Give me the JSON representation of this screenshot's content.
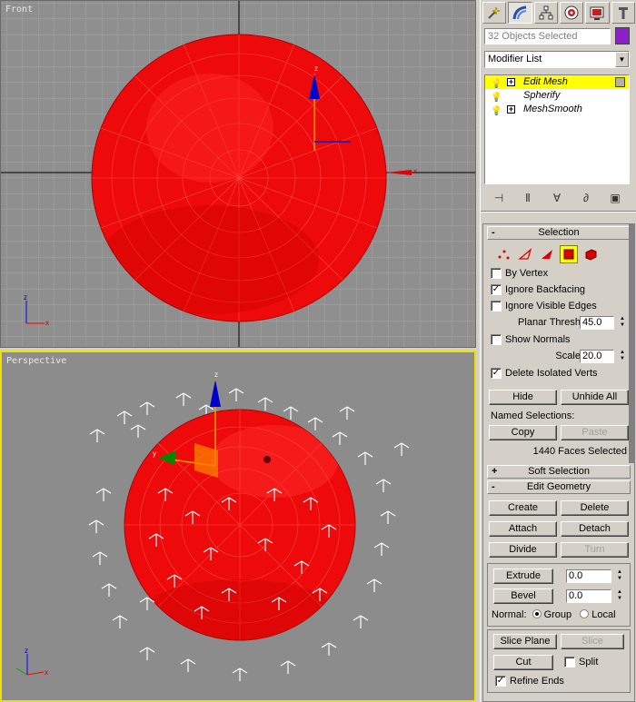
{
  "viewports": {
    "front": {
      "label": "Front"
    },
    "perspective": {
      "label": "Perspective"
    },
    "axes": {
      "x": "x",
      "y": "y",
      "z": "z"
    }
  },
  "panel": {
    "tab_icons": [
      "create-icon",
      "modify-icon",
      "hierarchy-icon",
      "motion-icon",
      "display-icon",
      "utilities-icon"
    ],
    "object_name": "32 Objects Selected",
    "object_color": "#8b1fc8",
    "modifier_list": "Modifier List",
    "stack": [
      {
        "label": "Edit Mesh",
        "selected": true,
        "expandable": true
      },
      {
        "label": "Spherify",
        "selected": false,
        "expandable": false
      },
      {
        "label": "MeshSmooth",
        "selected": false,
        "expandable": true
      }
    ]
  },
  "selection": {
    "title": "Selection",
    "sign": "-",
    "by_vertex": "By Vertex",
    "ignore_backfacing": "Ignore Backfacing",
    "ignore_visible_edges": "Ignore Visible Edges",
    "planar_thresh_label": "Planar Thresh:",
    "planar_thresh_value": "45.0",
    "show_normals": "Show Normals",
    "scale_label": "Scale:",
    "scale_value": "20.0",
    "delete_isolated": "Delete Isolated Verts",
    "hide": "Hide",
    "unhide_all": "Unhide All",
    "named_selections": "Named Selections:",
    "copy": "Copy",
    "paste": "Paste",
    "status": "1440 Faces Selected"
  },
  "soft_selection": {
    "title": "Soft Selection",
    "sign": "+"
  },
  "edit_geometry": {
    "title": "Edit Geometry",
    "sign": "-",
    "create": "Create",
    "delete": "Delete",
    "attach": "Attach",
    "detach": "Detach",
    "divide": "Divide",
    "turn": "Turn",
    "extrude": "Extrude",
    "extrude_value": "0.0",
    "bevel": "Bevel",
    "bevel_value": "0.0",
    "normal_label": "Normal:",
    "group": "Group",
    "local": "Local",
    "slice_plane": "Slice Plane",
    "slice": "Slice",
    "cut": "Cut",
    "split": "Split",
    "refine_ends": "Refine Ends"
  }
}
